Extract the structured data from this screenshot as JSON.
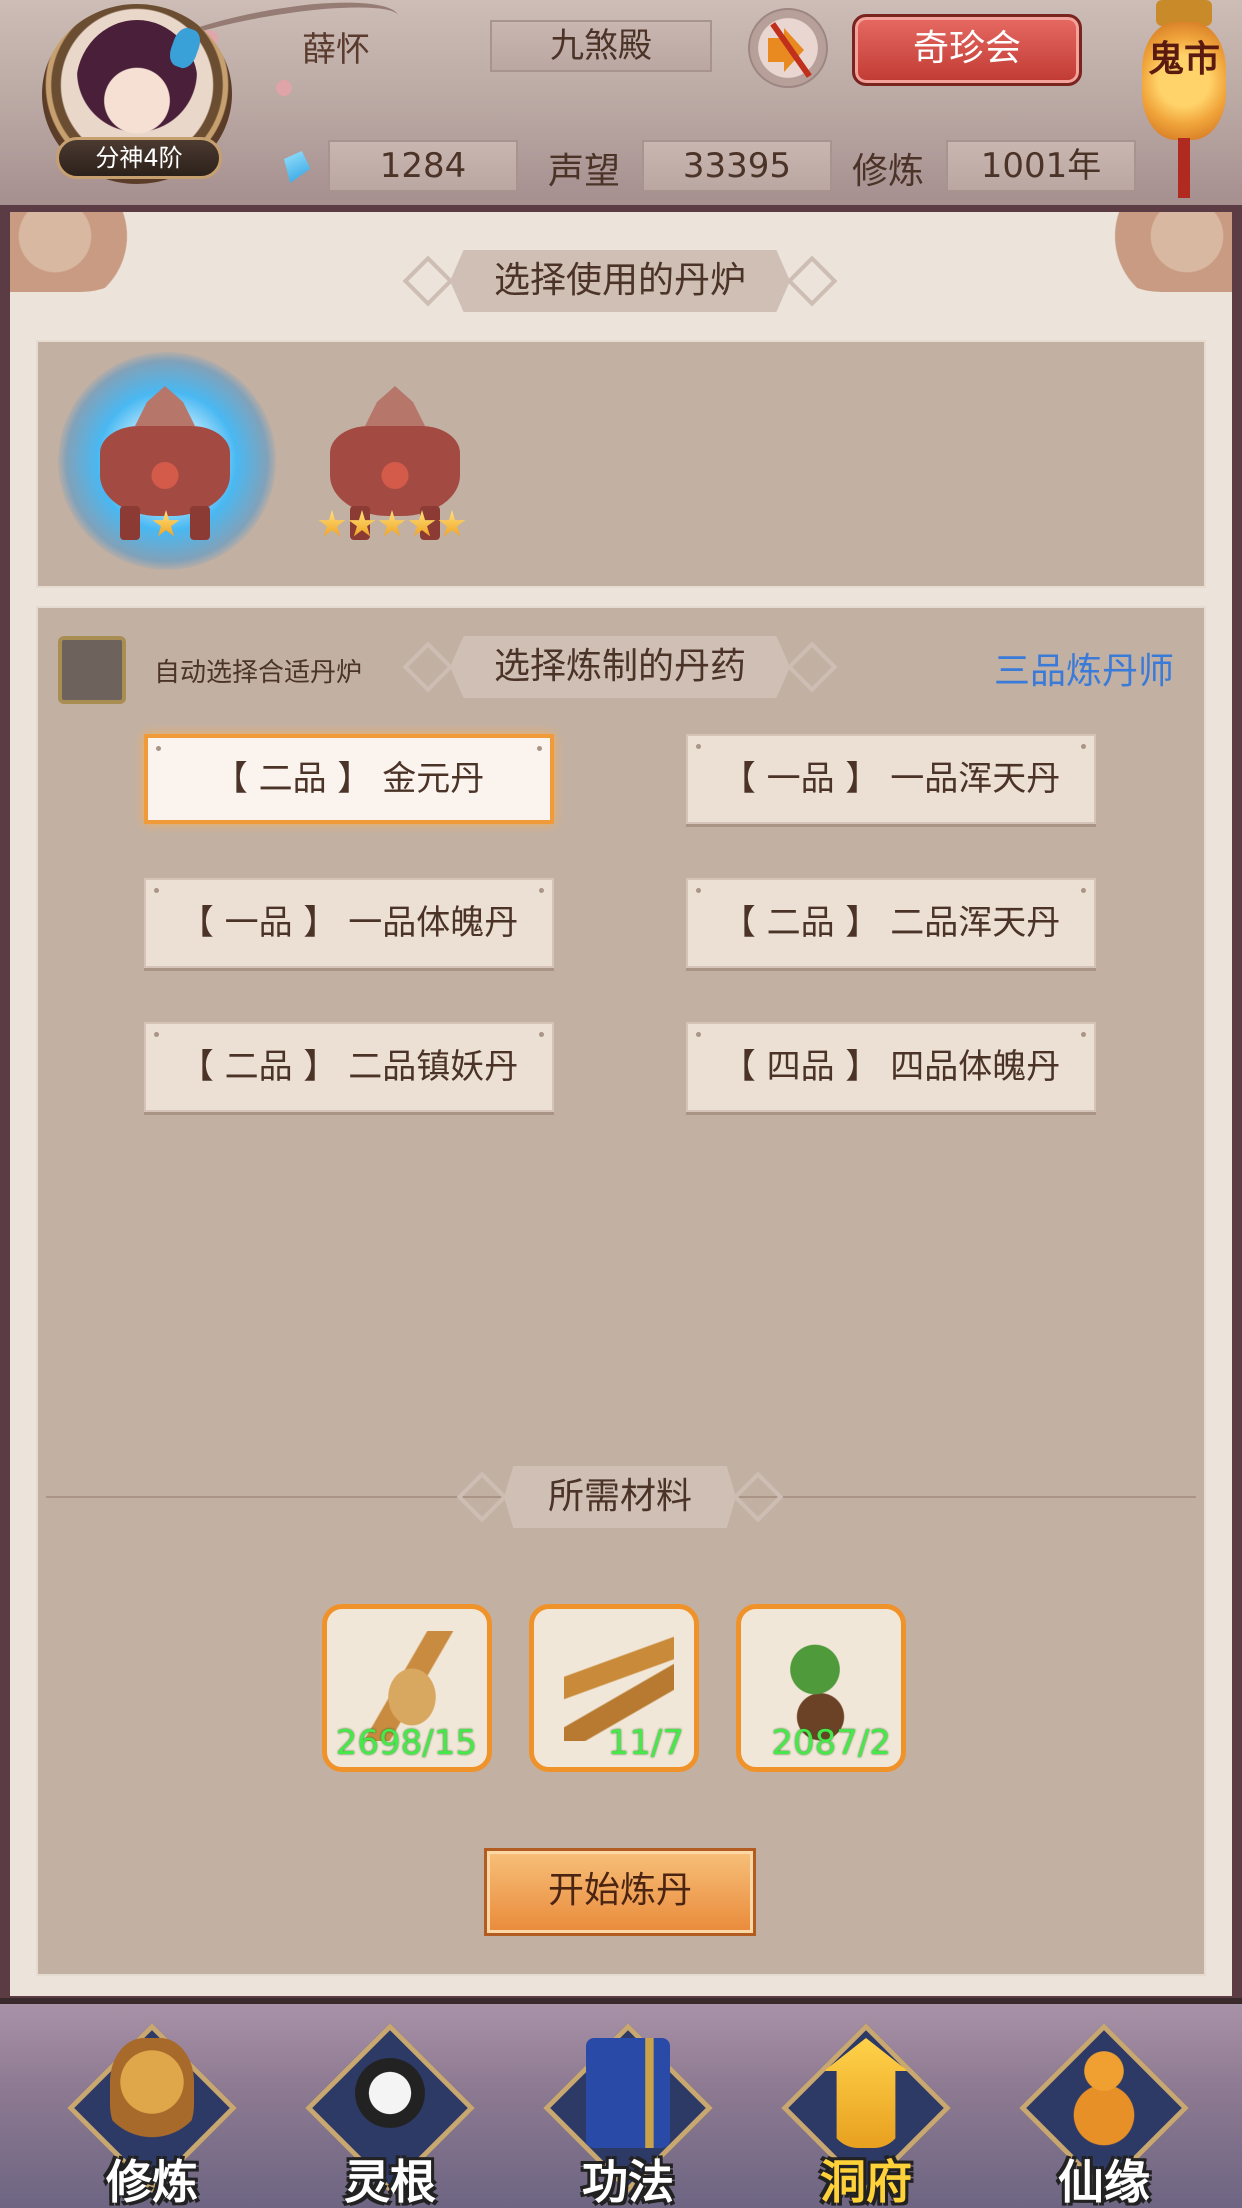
{
  "header": {
    "player_name": "薛怀",
    "rank_badge": "分神4阶",
    "sect": "九煞殿",
    "treasure_button": "奇珍会",
    "ghost_market": "鬼市",
    "gems": "1284",
    "reputation_label": "声望",
    "reputation": "33395",
    "cultivation_label": "修炼",
    "cultivation": "1001年",
    "sound_icon": "speaker-muted-icon"
  },
  "furnace_section": {
    "title": "选择使用的丹炉",
    "furnaces": [
      {
        "stars": 1,
        "selected": true
      },
      {
        "stars": 5,
        "selected": false
      }
    ]
  },
  "pill_section": {
    "title": "选择炼制的丹药",
    "auto_select_label": "自动选择合适丹炉",
    "alchemist_rank": "三品炼丹师",
    "pills": [
      {
        "label": "【 二品 】 金元丹",
        "selected": true
      },
      {
        "label": "【 一品 】 一品浑天丹",
        "selected": false
      },
      {
        "label": "【 一品 】 一品体魄丹",
        "selected": false
      },
      {
        "label": "【 二品 】 二品浑天丹",
        "selected": false
      },
      {
        "label": "【 二品 】 二品镇妖丹",
        "selected": false
      },
      {
        "label": "【 四品 】 四品体魄丹",
        "selected": false
      }
    ]
  },
  "materials_section": {
    "title": "所需材料",
    "items": [
      {
        "icon": "ginseng-icon",
        "count": "2698/15"
      },
      {
        "icon": "cordyceps-icon",
        "count": "11/7"
      },
      {
        "icon": "herb-icon",
        "count": "2087/2"
      }
    ]
  },
  "start_button": "开始炼丹",
  "colors": {
    "accent_orange": "#f09a3a",
    "rank_blue": "#3a7ad8",
    "count_green": "#46e84a"
  },
  "nav": [
    {
      "label": "修炼",
      "icon": "cultivate-icon",
      "active": false
    },
    {
      "label": "灵根",
      "icon": "spirit-root-icon",
      "active": false
    },
    {
      "label": "功法",
      "icon": "technique-book-icon",
      "active": false
    },
    {
      "label": "洞府",
      "icon": "cave-dwelling-icon",
      "active": true
    },
    {
      "label": "仙缘",
      "icon": "gourd-icon",
      "active": false
    }
  ]
}
